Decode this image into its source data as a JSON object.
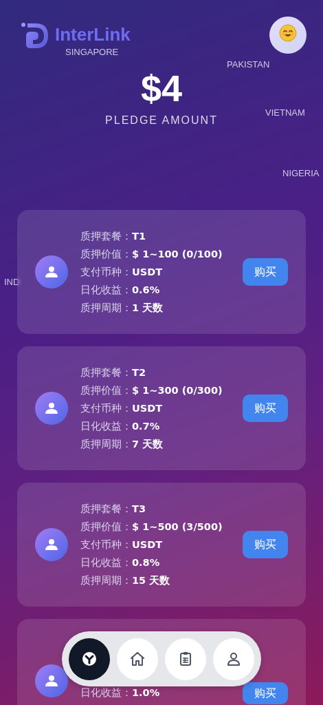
{
  "header": {
    "logo": "InterLink"
  },
  "pledge": {
    "amount": "$4",
    "label": "PLEDGE AMOUNT"
  },
  "countries": [
    {
      "name": "SINGAPORE"
    },
    {
      "name": "PAKISTAN"
    },
    {
      "name": "VIETNAM"
    },
    {
      "name": "NIGERIA"
    },
    {
      "name": "IND"
    }
  ],
  "plans": [
    {
      "rows": [
        {
          "label": "质押套餐：",
          "value": "T1"
        },
        {
          "label": "质押价值：",
          "value": "$ 1~100 (0/100)"
        },
        {
          "label": "支付币种：",
          "value": "USDT"
        },
        {
          "label": "日化收益：",
          "value": "0.6%"
        },
        {
          "label": "质押周期：",
          "value": "1 天数"
        }
      ],
      "button": "购买"
    },
    {
      "rows": [
        {
          "label": "质押套餐：",
          "value": "T2"
        },
        {
          "label": "质押价值：",
          "value": "$ 1~300 (0/300)"
        },
        {
          "label": "支付币种：",
          "value": "USDT"
        },
        {
          "label": "日化收益：",
          "value": "0.7%"
        },
        {
          "label": "质押周期：",
          "value": "7 天数"
        }
      ],
      "button": "购买"
    },
    {
      "rows": [
        {
          "label": "质押套餐：",
          "value": "T3"
        },
        {
          "label": "质押价值：",
          "value": "$ 1~500 (3/500)"
        },
        {
          "label": "支付币种：",
          "value": "USDT"
        },
        {
          "label": "日化收益：",
          "value": "0.8%"
        },
        {
          "label": "质押周期：",
          "value": "15 天数"
        }
      ],
      "button": "购买"
    },
    {
      "rows": [
        {
          "label": "日化收益：",
          "value": "1.0%"
        }
      ],
      "button": "购买"
    }
  ],
  "nav": [
    {
      "kind": "network",
      "selected": true
    },
    {
      "kind": "home",
      "selected": false
    },
    {
      "kind": "clipboard",
      "selected": false
    },
    {
      "kind": "user",
      "selected": false
    }
  ]
}
